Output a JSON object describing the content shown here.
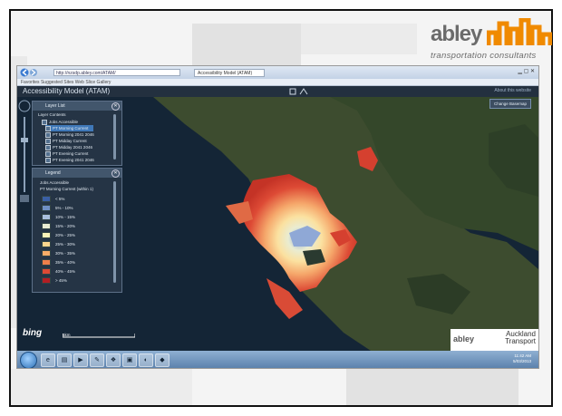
{
  "branding": {
    "logo_word": "abley",
    "logo_tagline": "transportation consultants",
    "logo_color": "#f08a00"
  },
  "browser": {
    "address": "http://nzsdp.abley.com/ATAM/",
    "tab_title": "Accessibility Model (ATAM)",
    "command_bar": "Favorites   Suggested Sites   Web Slice Gallery"
  },
  "app": {
    "title": "Accessibility Model (ATAM)",
    "header_right": "About this website",
    "toolbar_button": "Change Basemap"
  },
  "layers_panel": {
    "title": "Layer List",
    "subtitle": "Layer Contents",
    "group": "Jobs Accessible",
    "items": [
      "PT Morning Current",
      "PT Morning 2041 2046",
      "PT Midday Current",
      "PT Midday 2041 2046",
      "PT Evening Current",
      "PT Evening 2041 2046"
    ]
  },
  "legend_panel": {
    "title": "Legend",
    "group": "Jobs Accessible",
    "layer": "PT Morning Current (within 1)",
    "classes": [
      {
        "label": "< 5%",
        "color": "#3a5fa5"
      },
      {
        "label": "5% - 10%",
        "color": "#6f8fc4"
      },
      {
        "label": "10% - 15%",
        "color": "#a9bfdd"
      },
      {
        "label": "15% - 20%",
        "color": "#e9ecd2"
      },
      {
        "label": "20% - 25%",
        "color": "#fbf3b9"
      },
      {
        "label": "25% - 30%",
        "color": "#fbd58e"
      },
      {
        "label": "30% - 35%",
        "color": "#f7ad68"
      },
      {
        "label": "35% - 40%",
        "color": "#ef7f4b"
      },
      {
        "label": "40% - 45%",
        "color": "#dd4a35"
      },
      {
        "label": "> 45%",
        "color": "#b31e24"
      }
    ]
  },
  "map": {
    "provider": "bing",
    "scale_label": "5km",
    "partner_left": "abley",
    "partner_right": "Auckland Transport"
  },
  "taskbar": {
    "clock_time": "11:42 AM",
    "clock_date": "5/03/2013"
  }
}
